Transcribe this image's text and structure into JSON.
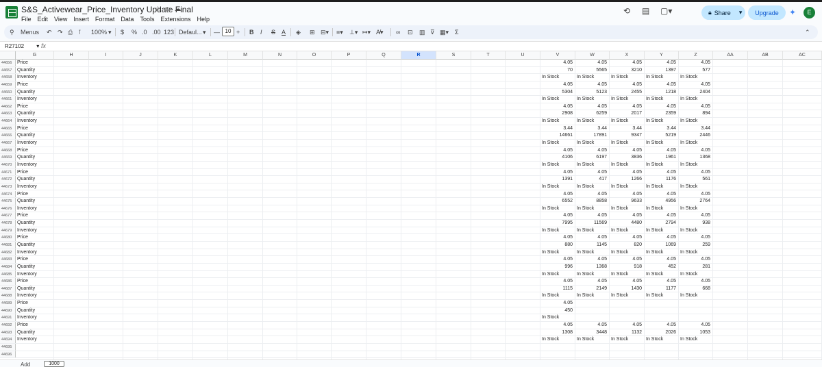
{
  "app": {
    "title": "S&S_Activewear_Price_Inventory Update Final",
    "menus": [
      "File",
      "Edit",
      "View",
      "Insert",
      "Format",
      "Data",
      "Tools",
      "Extensions",
      "Help"
    ],
    "share_label": "Share",
    "upgrade_label": "Upgrade",
    "avatar_letter": "E"
  },
  "toolbar": {
    "search_label": "Menus",
    "zoom": "100%",
    "currency": "$",
    "percent": "%",
    "dec_decrease": ".0",
    "dec_increase": ".00",
    "number_format": "123",
    "font": "Defaul...",
    "minus": "—",
    "font_size": "10",
    "plus": "+",
    "bold": "B",
    "italic": "I",
    "strike": "S",
    "text_color": "A",
    "sum": "Σ"
  },
  "formula_bar": {
    "name_box": "R27102",
    "fx": "fx"
  },
  "columns": [
    "G",
    "H",
    "I",
    "J",
    "K",
    "L",
    "M",
    "N",
    "O",
    "P",
    "Q",
    "R",
    "S",
    "T",
    "U",
    "V",
    "W",
    "X",
    "Y",
    "Z",
    "AA",
    "AB",
    "AC"
  ],
  "selected_column": "R",
  "rows": [
    {
      "n": "44656",
      "g": "Price",
      "v": [
        "4.05",
        "4.05",
        "4.05",
        "4.05",
        "4.05"
      ]
    },
    {
      "n": "44657",
      "g": "Quantity",
      "v": [
        "70",
        "5565",
        "3210",
        "1397",
        "577"
      ]
    },
    {
      "n": "44658",
      "g": "Inventory",
      "v": [
        "In Stock",
        "In Stock",
        "In Stock",
        "In Stock",
        "In Stock"
      ]
    },
    {
      "n": "44659",
      "g": "Price",
      "v": [
        "4.05",
        "4.05",
        "4.05",
        "4.05",
        "4.05"
      ]
    },
    {
      "n": "44660",
      "g": "Quantity",
      "v": [
        "5304",
        "5123",
        "2455",
        "1218",
        "2404"
      ]
    },
    {
      "n": "44661",
      "g": "Inventory",
      "v": [
        "In Stock",
        "In Stock",
        "In Stock",
        "In Stock",
        "In Stock"
      ]
    },
    {
      "n": "44662",
      "g": "Price",
      "v": [
        "4.05",
        "4.05",
        "4.05",
        "4.05",
        "4.05"
      ]
    },
    {
      "n": "44663",
      "g": "Quantity",
      "v": [
        "2908",
        "6259",
        "2017",
        "2359",
        "894"
      ]
    },
    {
      "n": "44664",
      "g": "Inventory",
      "v": [
        "In Stock",
        "In Stock",
        "In Stock",
        "In Stock",
        "In Stock"
      ]
    },
    {
      "n": "44665",
      "g": "Price",
      "v": [
        "3.44",
        "3.44",
        "3.44",
        "3.44",
        "3.44"
      ]
    },
    {
      "n": "44666",
      "g": "Quantity",
      "v": [
        "14661",
        "17891",
        "9347",
        "5219",
        "2446"
      ]
    },
    {
      "n": "44667",
      "g": "Inventory",
      "v": [
        "In Stock",
        "In Stock",
        "In Stock",
        "In Stock",
        "In Stock"
      ]
    },
    {
      "n": "44668",
      "g": "Price",
      "v": [
        "4.05",
        "4.05",
        "4.05",
        "4.05",
        "4.05"
      ]
    },
    {
      "n": "44669",
      "g": "Quantity",
      "v": [
        "4106",
        "6197",
        "3836",
        "1961",
        "1368"
      ]
    },
    {
      "n": "44670",
      "g": "Inventory",
      "v": [
        "In Stock",
        "In Stock",
        "In Stock",
        "In Stock",
        "In Stock"
      ]
    },
    {
      "n": "44671",
      "g": "Price",
      "v": [
        "4.05",
        "4.05",
        "4.05",
        "4.05",
        "4.05"
      ]
    },
    {
      "n": "44672",
      "g": "Quantity",
      "v": [
        "1391",
        "417",
        "1266",
        "1176",
        "561"
      ]
    },
    {
      "n": "44673",
      "g": "Inventory",
      "v": [
        "In Stock",
        "In Stock",
        "In Stock",
        "In Stock",
        "In Stock"
      ]
    },
    {
      "n": "44674",
      "g": "Price",
      "v": [
        "4.05",
        "4.05",
        "4.05",
        "4.05",
        "4.05"
      ]
    },
    {
      "n": "44675",
      "g": "Quantity",
      "v": [
        "6552",
        "8858",
        "9633",
        "4956",
        "2764"
      ]
    },
    {
      "n": "44676",
      "g": "Inventory",
      "v": [
        "In Stock",
        "In Stock",
        "In Stock",
        "In Stock",
        "In Stock"
      ]
    },
    {
      "n": "44677",
      "g": "Price",
      "v": [
        "4.05",
        "4.05",
        "4.05",
        "4.05",
        "4.05"
      ]
    },
    {
      "n": "44678",
      "g": "Quantity",
      "v": [
        "7995",
        "11569",
        "4480",
        "2794",
        "938"
      ]
    },
    {
      "n": "44679",
      "g": "Inventory",
      "v": [
        "In Stock",
        "In Stock",
        "In Stock",
        "In Stock",
        "In Stock"
      ]
    },
    {
      "n": "44680",
      "g": "Price",
      "v": [
        "4.05",
        "4.05",
        "4.05",
        "4.05",
        "4.05"
      ]
    },
    {
      "n": "44681",
      "g": "Quantity",
      "v": [
        "880",
        "1145",
        "820",
        "1069",
        "259"
      ]
    },
    {
      "n": "44682",
      "g": "Inventory",
      "v": [
        "In Stock",
        "In Stock",
        "In Stock",
        "In Stock",
        "In Stock"
      ]
    },
    {
      "n": "44683",
      "g": "Price",
      "v": [
        "4.05",
        "4.05",
        "4.05",
        "4.05",
        "4.05"
      ]
    },
    {
      "n": "44684",
      "g": "Quantity",
      "v": [
        "996",
        "1368",
        "918",
        "452",
        "281"
      ]
    },
    {
      "n": "44685",
      "g": "Inventory",
      "v": [
        "In Stock",
        "In Stock",
        "In Stock",
        "In Stock",
        "In Stock"
      ]
    },
    {
      "n": "44686",
      "g": "Price",
      "v": [
        "4.05",
        "4.05",
        "4.05",
        "4.05",
        "4.05"
      ]
    },
    {
      "n": "44687",
      "g": "Quantity",
      "v": [
        "1115",
        "2149",
        "1430",
        "1177",
        "668"
      ]
    },
    {
      "n": "44688",
      "g": "Inventory",
      "v": [
        "In Stock",
        "In Stock",
        "In Stock",
        "In Stock",
        "In Stock"
      ]
    },
    {
      "n": "44689",
      "g": "Price",
      "v": [
        "4.05",
        "",
        "",
        "",
        ""
      ]
    },
    {
      "n": "44690",
      "g": "Quantity",
      "v": [
        "450",
        "",
        "",
        "",
        ""
      ]
    },
    {
      "n": "44691",
      "g": "Inventory",
      "v": [
        "In Stock",
        "",
        "",
        "",
        ""
      ]
    },
    {
      "n": "44692",
      "g": "Price",
      "v": [
        "4.05",
        "4.05",
        "4.05",
        "4.05",
        "4.05"
      ]
    },
    {
      "n": "44693",
      "g": "Quantity",
      "v": [
        "1308",
        "3448",
        "1132",
        "2026",
        "1053"
      ]
    },
    {
      "n": "44694",
      "g": "Inventory",
      "v": [
        "In Stock",
        "In Stock",
        "In Stock",
        "In Stock",
        "In Stock"
      ]
    },
    {
      "n": "44695",
      "g": "",
      "v": [
        "",
        "",
        "",
        "",
        ""
      ]
    },
    {
      "n": "44696",
      "g": "",
      "v": [
        "",
        "",
        "",
        "",
        ""
      ]
    }
  ],
  "bottom": {
    "add_label": "Add",
    "rows_value": "1000"
  }
}
